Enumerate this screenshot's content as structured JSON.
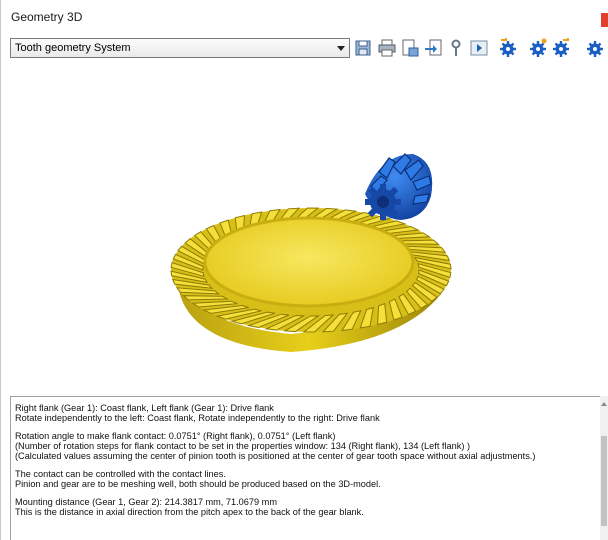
{
  "window": {
    "title": "Geometry 3D",
    "close_color": "#e2402f"
  },
  "toolbar": {
    "view_select": {
      "value": "Tooth geometry System"
    },
    "buttons": [
      {
        "name": "save-icon"
      },
      {
        "name": "print-icon"
      },
      {
        "name": "export-icon"
      },
      {
        "name": "import-icon"
      },
      {
        "name": "settings-icon"
      },
      {
        "name": "play-icon"
      },
      {
        "name": "gear-rotate-left-icon"
      },
      {
        "name": "gear-icon"
      },
      {
        "name": "gear-rotate-right-icon"
      },
      {
        "name": "gear-pair-icon"
      }
    ]
  },
  "viewport": {
    "gear_color": "#f1dd22",
    "pinion_color": "#1565d8"
  },
  "info": {
    "lines": [
      "Right flank (Gear 1): Coast flank, Left flank (Gear 1): Drive flank",
      "Rotate independently to the left: Coast flank, Rotate independently to the right: Drive flank",
      "",
      "Rotation angle to make flank contact: 0.0751° (Right flank), 0.0751° (Left flank)",
      "  (Number of rotation steps for flank contact to be set in the properties window: 134 (Right flank), 134 (Left flank) )",
      "(Calculated values assuming the center of pinion tooth is positioned at the center of gear tooth space without axial adjustments.)",
      "",
      "The contact can be controlled with the contact lines.",
      "Pinion and gear are to be meshing well, both should be produced based on the 3D-model.",
      "",
      "Mounting distance (Gear 1, Gear 2): 214.3817 mm, 71.0679 mm",
      "This is the distance in axial direction from the pitch apex to the back of the gear blank."
    ]
  }
}
